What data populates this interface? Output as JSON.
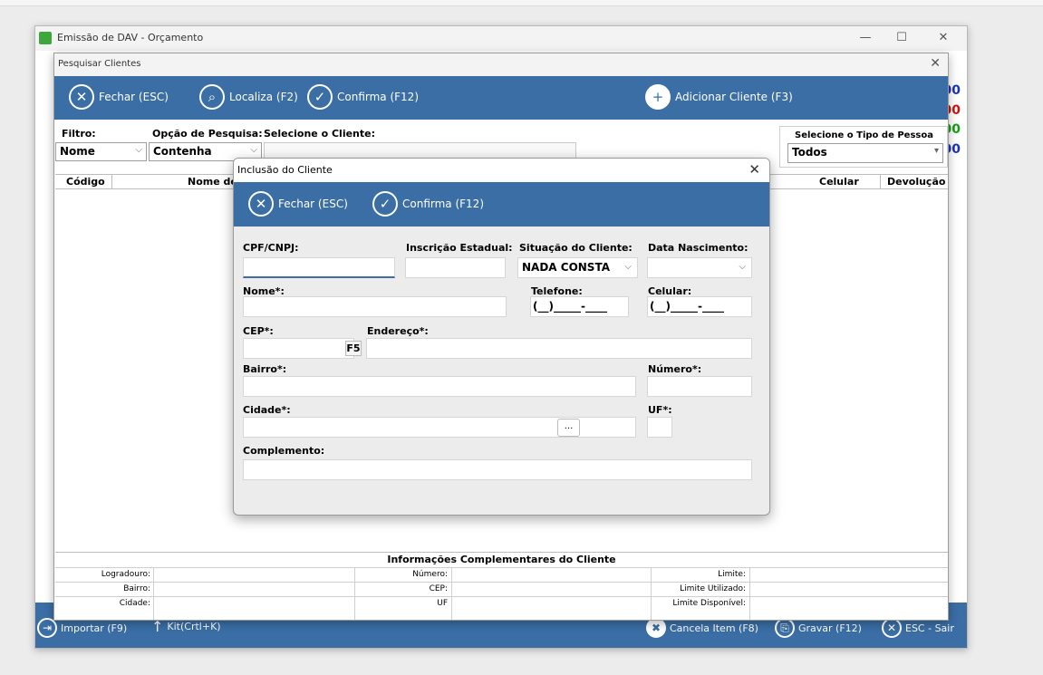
{
  "main_window": {
    "title": "Emissão de DAV - Orçamento",
    "controls": {
      "minimize": "—",
      "maximize": "☐",
      "close": "✕"
    },
    "right_values": [
      "00",
      "00",
      "00",
      "00"
    ],
    "right_colors": [
      "#1a33c0",
      "#d01010",
      "#10a010",
      "#1a33c0"
    ],
    "bottom_bar": {
      "importar": "Importar (F9)",
      "kit": "Kit(Crtl+K)",
      "cancela": "Cancela Item (F8)",
      "gravar": "Gravar (F12)",
      "sair": "ESC - Sair"
    }
  },
  "search_window": {
    "title": "Pesquisar Clientes",
    "close": "✕",
    "toolbar": {
      "fechar": "Fechar (ESC)",
      "localiza": "Localiza (F2)",
      "confirma": "Confirma (F12)",
      "adicionar": "Adicionar Cliente (F3)"
    },
    "filtro_label": "Filtro:",
    "filtro_value": "Nome",
    "opcao_label": "Opção de Pesquisa:",
    "opcao_value": "Contenha",
    "selecione_label": "Selecione o Cliente:",
    "tipo_pessoa_label": "Selecione o Tipo de Pessoa",
    "tipo_pessoa_value": "Todos",
    "columns": [
      "Código",
      "Nome do",
      "Celular",
      "Devolução"
    ],
    "info_title": "Informações Complementares do Cliente",
    "info_rows": [
      [
        "Logradouro:",
        "Número:",
        "Limite:"
      ],
      [
        "Bairro:",
        "CEP:",
        "Limite Utilizado:"
      ],
      [
        "Cidade:",
        "UF",
        "Limite Disponível:"
      ]
    ]
  },
  "inclusao_dialog": {
    "title": "Inclusão do Cliente",
    "close": "✕",
    "toolbar": {
      "fechar": "Fechar (ESC)",
      "confirma": "Confirma (F12)"
    },
    "labels": {
      "cpf": "CPF/CNPJ:",
      "inscricao": "Inscrição Estadual:",
      "situacao": "Situação do Cliente:",
      "nascimento": "Data Nascimento:",
      "nome": "Nome*:",
      "telefone": "Telefone:",
      "celular": "Celular:",
      "cep": "CEP*:",
      "endereco": "Endereço*:",
      "bairro": "Bairro*:",
      "numero": "Número*:",
      "cidade": "Cidade*:",
      "uf": "UF*:",
      "complemento": "Complemento:"
    },
    "values": {
      "situacao": "NADA CONSTA",
      "telefone_mask": "(__)_____-____",
      "celular_mask": "(__)_____-____",
      "f5": "F5",
      "cidade_lookup": "..."
    }
  }
}
